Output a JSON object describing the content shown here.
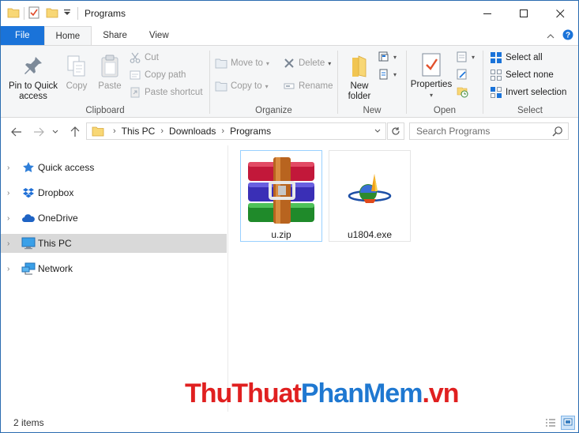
{
  "window": {
    "title": "Programs"
  },
  "tabs": [
    {
      "label": "File"
    },
    {
      "label": "Home"
    },
    {
      "label": "Share"
    },
    {
      "label": "View"
    }
  ],
  "ribbon": {
    "clipboard": {
      "label": "Clipboard",
      "pin_label_1": "Pin to Quick",
      "pin_label_2": "access",
      "copy": "Copy",
      "paste": "Paste",
      "cut": "Cut",
      "copy_path": "Copy path",
      "paste_shortcut": "Paste shortcut"
    },
    "organize": {
      "label": "Organize",
      "move_to": "Move to",
      "copy_to": "Copy to",
      "delete": "Delete",
      "rename": "Rename"
    },
    "new": {
      "label": "New",
      "new_folder_1": "New",
      "new_folder_2": "folder"
    },
    "open": {
      "label": "Open",
      "properties": "Properties"
    },
    "select": {
      "label": "Select",
      "select_all": "Select all",
      "select_none": "Select none",
      "invert_selection": "Invert selection"
    }
  },
  "address": {
    "parts": [
      "This PC",
      "Downloads",
      "Programs"
    ]
  },
  "search": {
    "placeholder": "Search Programs"
  },
  "navpane": {
    "items": [
      {
        "label": "Quick access",
        "icon": "star-icon"
      },
      {
        "label": "Dropbox",
        "icon": "dropbox-icon"
      },
      {
        "label": "OneDrive",
        "icon": "cloud-icon"
      },
      {
        "label": "This PC",
        "icon": "computer-icon",
        "selected": true
      },
      {
        "label": "Network",
        "icon": "network-icon"
      }
    ]
  },
  "files": [
    {
      "name": "u.zip",
      "icon": "winrar-archive-icon"
    },
    {
      "name": "u1804.exe",
      "icon": "ultrasurf-app-icon"
    }
  ],
  "watermark": {
    "part1": "ThuThuat",
    "part2": "PhanMem",
    "part3": ".vn"
  },
  "status": {
    "items": "2 items"
  },
  "colors": {
    "accent": "#1a73d9",
    "selection": "#d9d9d9",
    "watermark_red": "#e02020",
    "watermark_blue": "#1f78d1"
  }
}
